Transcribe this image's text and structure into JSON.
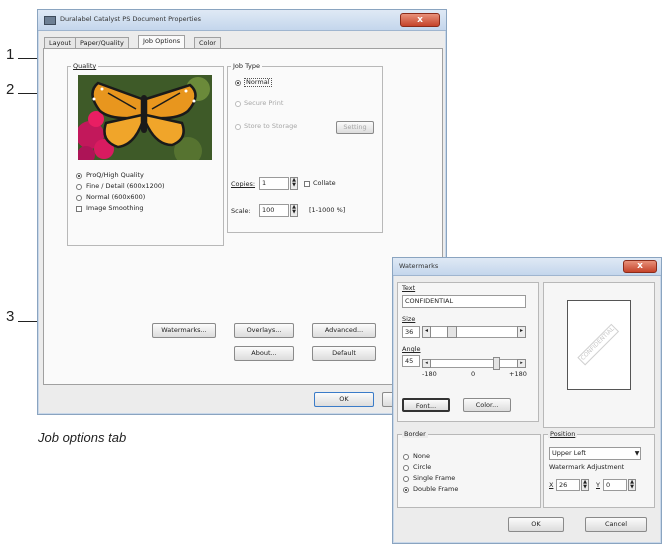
{
  "callouts": [
    "1",
    "2",
    "3"
  ],
  "caption": "Job options tab",
  "main_dialog": {
    "title": "Duralabel Catalyst PS Document Properties",
    "close_glyph": "x",
    "tabs": [
      "Layout",
      "Paper/Quality",
      "Job Options",
      "Color"
    ],
    "quality": {
      "label": "Quality",
      "options": [
        "ProQ/High Quality",
        "Fine / Detail (600x1200)",
        "Normal (600x600)"
      ],
      "selected_index": 0,
      "image_smoothing": "Image Smoothing"
    },
    "job_type": {
      "label": "Job Type",
      "options": [
        "Normal",
        "Secure Print",
        "Store to Storage"
      ],
      "selected_index": 0,
      "setting_button": "Setting"
    },
    "copies": {
      "label": "Copies:",
      "value": "1",
      "collate": "Collate"
    },
    "scale": {
      "label": "Scale:",
      "value": "100",
      "range": "[1-1000 %]"
    },
    "buttons": {
      "watermarks": "Watermarks...",
      "overlays": "Overlays...",
      "advanced": "Advanced...",
      "about": "About...",
      "default": "Default"
    },
    "ok": "OK"
  },
  "watermark_dialog": {
    "title": "Watermarks",
    "close_glyph": "x",
    "text_label": "Text",
    "text_value": "CONFIDENTIAL",
    "size_label": "Size",
    "size_value": "36",
    "angle_label": "Angle",
    "angle_value": "45",
    "angle_ticks": [
      "-180",
      "0",
      "+180"
    ],
    "font_button": "Font...",
    "color_button": "Color...",
    "preview_text": "CONFIDENTIAL",
    "border": {
      "label": "Border",
      "options": [
        "None",
        "Circle",
        "Single Frame",
        "Double Frame"
      ],
      "selected_index": 3
    },
    "position": {
      "label": "Position",
      "value": "Upper Left",
      "adjust_label": "Watermark Adjustment",
      "x_label": "X",
      "x_value": "26",
      "y_label": "Y",
      "y_value": "0"
    },
    "ok": "OK",
    "cancel": "Cancel"
  }
}
